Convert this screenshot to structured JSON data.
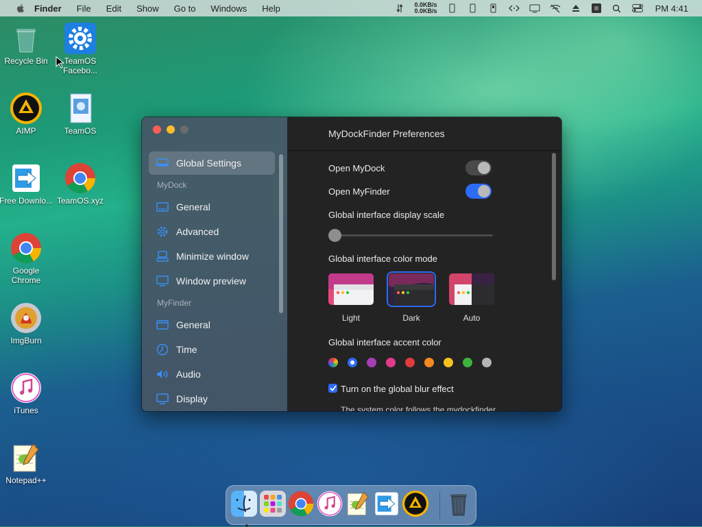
{
  "menubar": {
    "app_name": "Finder",
    "items": [
      "File",
      "Edit",
      "Show",
      "Go to",
      "Windows",
      "Help"
    ],
    "net_up": "0.0KB/s",
    "net_down": "0.0KB/s",
    "clock": "PM 4:41"
  },
  "desktop": {
    "icons": [
      {
        "label": "Recycle Bin"
      },
      {
        "label": "TeamOS Facebo..."
      },
      {
        "label": "AIMP"
      },
      {
        "label": "TeamOS"
      },
      {
        "label": "Free Downlo..."
      },
      {
        "label": "TeamOS.xyz"
      },
      {
        "label": "Google Chrome"
      },
      {
        "label": "ImgBurn"
      },
      {
        "label": "iTunes"
      },
      {
        "label": "Notepad++"
      }
    ]
  },
  "window": {
    "title": "MyDockFinder Preferences",
    "sidebar": {
      "global": "Global Settings",
      "section_mydock": "MyDock",
      "mydock_items": [
        "General",
        "Advanced",
        "Minimize window",
        "Window preview"
      ],
      "section_myfinder": "MyFinder",
      "myfinder_items": [
        "General",
        "Time",
        "Audio",
        "Display"
      ]
    },
    "settings": {
      "open_mydock": {
        "label": "Open MyDock",
        "on": false
      },
      "open_myfinder": {
        "label": "Open MyFinder",
        "on": true
      },
      "scale_label": "Global interface display scale",
      "scale_value": 0,
      "color_mode_label": "Global interface color mode",
      "modes": [
        "Light",
        "Dark",
        "Auto"
      ],
      "selected_mode": "Dark",
      "accent_label": "Global interface accent color",
      "accent_colors": [
        "multicolor",
        "#2d6cf5",
        "#a53fb6",
        "#e03b8a",
        "#e23b3b",
        "#f58a1f",
        "#f5c21f",
        "#3fb33f",
        "#b5b5b5"
      ],
      "selected_accent": "#2d6cf5",
      "blur_label": "Turn on the global blur effect",
      "blur_checked": true,
      "cutoff_text": "The system color follows the mydockfinder"
    }
  },
  "dock": {
    "apps": [
      "Finder",
      "Launchpad",
      "Chrome",
      "iTunes",
      "Notepad++",
      "Free Download Manager",
      "AIMP",
      "Trash"
    ]
  },
  "colors": {
    "accent": "#2d6cf5",
    "close": "#ff5f57",
    "minimize": "#febc2e",
    "zoom": "#6b6b6b"
  }
}
